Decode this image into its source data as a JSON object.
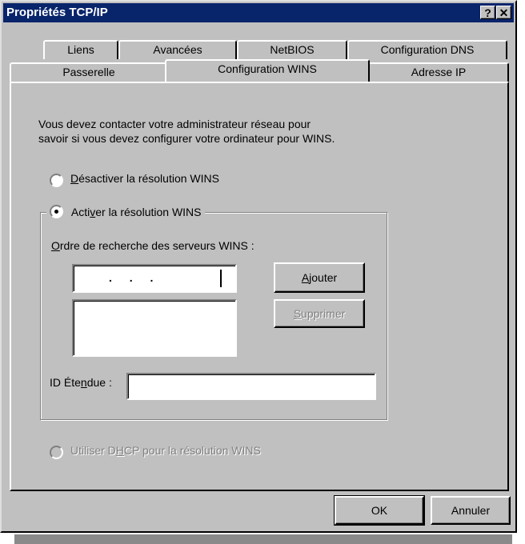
{
  "window": {
    "title": "Propriétés TCP/IP",
    "help_icon": "?",
    "close_icon": "✕"
  },
  "tabs": {
    "row1": [
      "Liens",
      "Avancées",
      "NetBIOS",
      "Configuration DNS"
    ],
    "row2": [
      "Passerelle",
      "Configuration WINS",
      "Adresse IP"
    ],
    "active": "Configuration WINS"
  },
  "intro": {
    "line1": "Vous devez contacter votre administrateur réseau pour",
    "line2": "savoir si vous devez configurer votre ordinateur pour WINS."
  },
  "options": {
    "disable": {
      "pre": "",
      "mn": "D",
      "post": "ésactiver la résolution WINS",
      "selected": false
    },
    "enable": {
      "pre": "Acti",
      "mn": "v",
      "post": "er la résolution WINS",
      "selected": true
    },
    "dhcp": {
      "pre": "Utiliser D",
      "mn": "H",
      "post": "CP pour la résolution WINS",
      "disabled": true
    }
  },
  "servers": {
    "label_mn": "O",
    "label_rest": "rdre de recherche des serveurs WINS :",
    "ip_dots": ".   .   .",
    "add_mn": "A",
    "add_rest": "jouter",
    "remove_mn": "S",
    "remove_rest": "upprimer"
  },
  "scope": {
    "pre": "ID Éte",
    "mn": "n",
    "post": "due :",
    "value": ""
  },
  "footer": {
    "ok": "OK",
    "cancel": "Annuler"
  }
}
